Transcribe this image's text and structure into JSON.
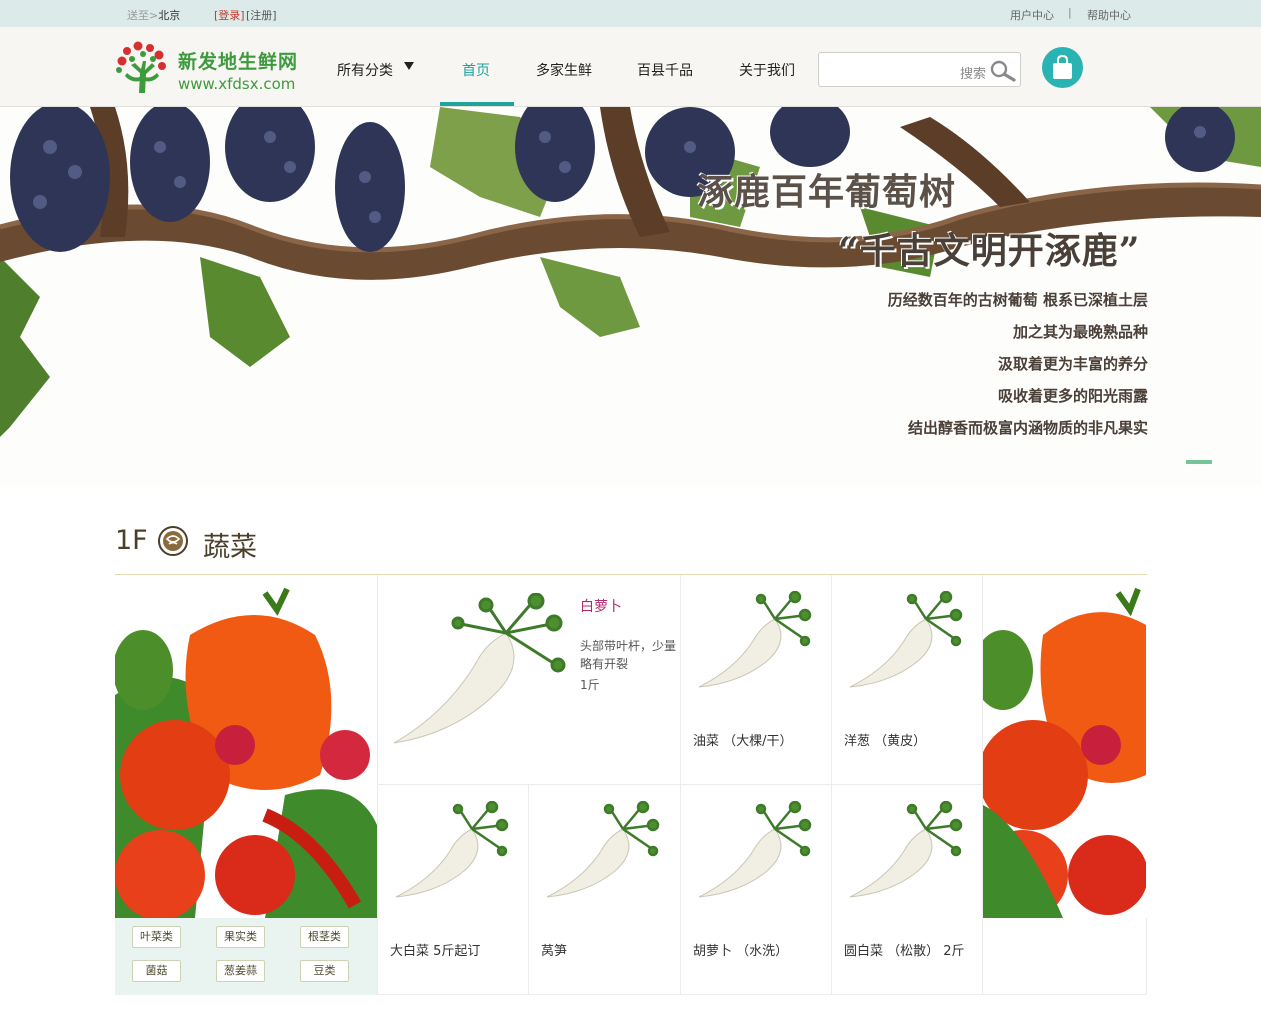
{
  "topbar": {
    "deliver_prefix": "送至>",
    "city": "北京",
    "login": "[登录]",
    "register": "[注册]",
    "user_center": "用户中心",
    "separator": "|",
    "help_center": "帮助中心"
  },
  "logo": {
    "name": "新发地生鲜网",
    "url": "www.xfdsx.com"
  },
  "nav": {
    "categories": "所有分类",
    "items": [
      "首页",
      "多家生鲜",
      "百县千品",
      "关于我们"
    ],
    "active_index": 0
  },
  "search": {
    "label": "搜索",
    "value": ""
  },
  "banner": {
    "title1": "涿鹿百年葡萄树",
    "title2": "“千古文明开涿鹿”",
    "lines": [
      "历经数百年的古树葡萄 根系已深植土层",
      "加之其为最晚熟品种",
      "汲取着更为丰富的养分",
      "吸收着更多的阳光雨露",
      "结出醇香而极富内涵物质的非凡果实"
    ]
  },
  "floor": {
    "number": "1F",
    "title": "蔬菜",
    "tags": [
      "叶菜类",
      "果实类",
      "根茎类",
      "菌菇",
      "葱姜蒜",
      "豆类"
    ],
    "featured": {
      "name": "白萝卜",
      "desc": "头部带叶杆，少量略有开裂",
      "qty": "1斤"
    },
    "products": [
      "油菜 （大棵/干）",
      "洋葱 （黄皮）",
      "大白菜 5斤起订",
      "莴笋",
      "胡萝卜 （水洗）",
      "圆白菜 （松散） 2斤"
    ]
  },
  "colors": {
    "accent": "#1fa39a",
    "brand_green": "#3d9a3d",
    "topbar_bg": "#dcebea",
    "featured_name": "#b5296b"
  }
}
